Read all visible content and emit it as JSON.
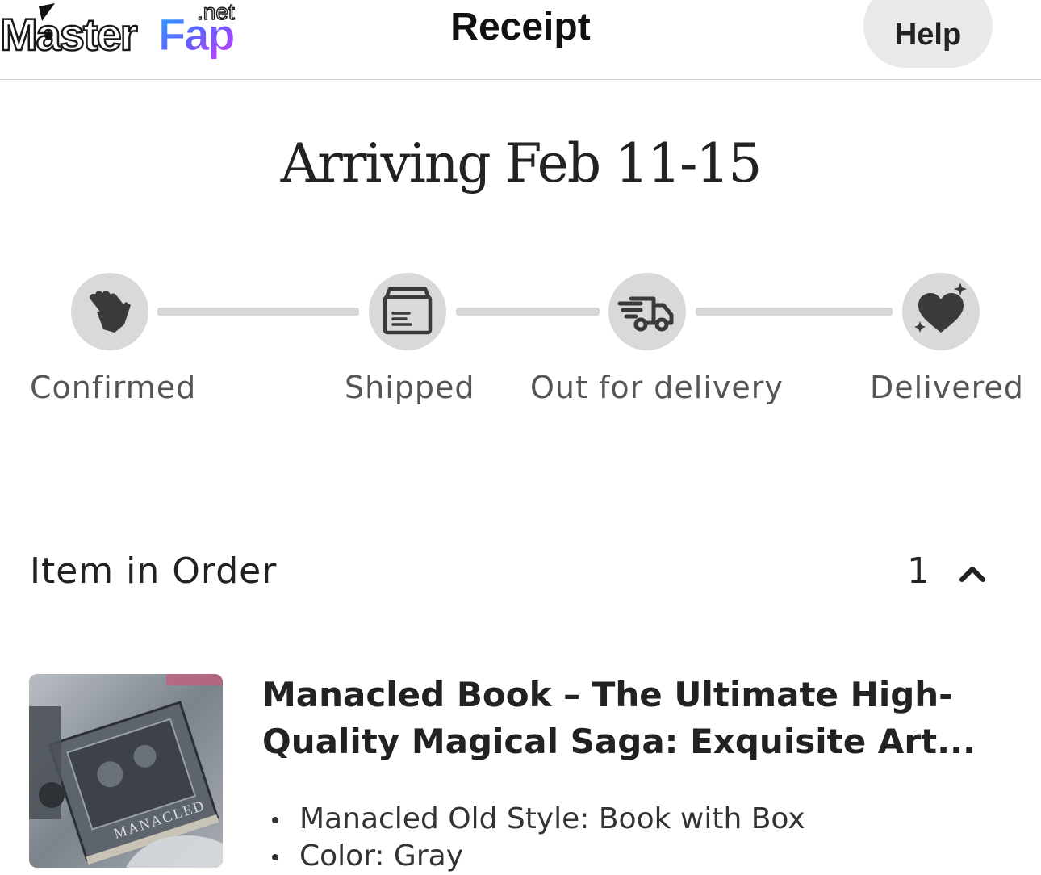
{
  "header": {
    "logo_text": "MasterFap",
    "logo_suffix": ".net",
    "title": "Receipt",
    "help_label": "Help"
  },
  "arrival": {
    "text": "Arriving Feb 11-15"
  },
  "tracker": {
    "steps": [
      {
        "label": "Confirmed",
        "icon": "waving-hand-icon"
      },
      {
        "label": "Shipped",
        "icon": "package-box-icon"
      },
      {
        "label": "Out for delivery",
        "icon": "delivery-truck-icon"
      },
      {
        "label": "Delivered",
        "icon": "sparkle-heart-icon"
      }
    ]
  },
  "items": {
    "title": "Item in Order",
    "count": "1",
    "toggle_icon": "chevron-up-icon"
  },
  "product": {
    "title_line1": "Manacled Book – The Ultimate High-",
    "title_line2": "Quality Magical Saga: Exquisite Art...",
    "thumb_text": "MANACLED",
    "variants": [
      "Manacled Old Style: Book with Box",
      "Color: Gray"
    ]
  },
  "colors": {
    "logo_gradient_start": "#1ea7ff",
    "logo_gradient_end": "#c43bff",
    "circle_bg": "#d9d9d9",
    "icon": "#3a3a3a",
    "track": "#d6d6d6",
    "help_bg": "#e9e9e9"
  }
}
